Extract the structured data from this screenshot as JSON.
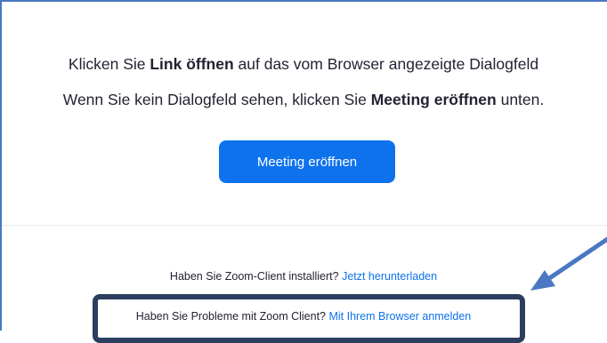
{
  "prompt": {
    "line1_pre": "Klicken Sie ",
    "line1_bold": "Link öffnen",
    "line1_post": " auf das vom Browser angezeigte Dialogfeld",
    "line2_pre": "Wenn Sie kein Dialogfeld sehen, klicken Sie ",
    "line2_bold": "Meeting eröffnen",
    "line2_post": " unten."
  },
  "launch_button": {
    "label": "Meeting eröffnen"
  },
  "footer": {
    "download_text": "Haben Sie Zoom-Client installiert? ",
    "download_link": "Jetzt herunterladen",
    "browser_text": "Haben Sie Probleme mit Zoom Client? ",
    "browser_link": "Mit Ihrem Browser anmelden"
  },
  "colors": {
    "accent": "#0e72ed",
    "text": "#232333",
    "annotation": "#4a78c2",
    "highlight_border": "#2b3e5e"
  },
  "annotation": {
    "icon": "arrow-icon"
  }
}
